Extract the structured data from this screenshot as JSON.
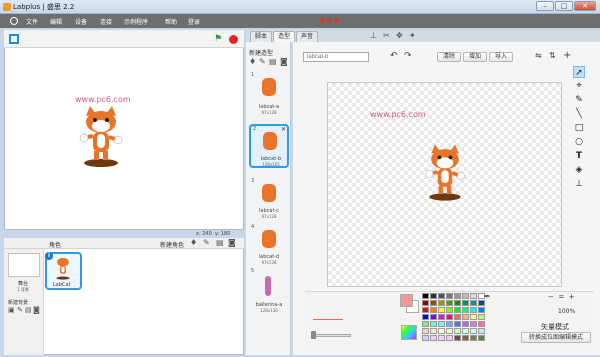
{
  "window": {
    "title": "Labplus | 盛思 2.2",
    "minimize": "–",
    "maximize": "□",
    "close": "✕"
  },
  "menu": [
    "文件",
    "编辑",
    "设备",
    "连接",
    "示例程序",
    "帮助",
    "登录"
  ],
  "stage": {
    "x_label": "x:",
    "x_value": "240",
    "y_label": "y:",
    "y_value": "180",
    "watermark": "www.pc6.com"
  },
  "sprite_pane": {
    "title": "角色",
    "new_sprite_label": "新建角色",
    "stage_label": "舞台",
    "stage_sub": "1 背景",
    "new_backdrop_label": "新建背景",
    "sprite_name": "LabCat",
    "info_glyph": "i"
  },
  "tabs": [
    "脚本",
    "造型",
    "声音"
  ],
  "costume_panel": {
    "title": "新建造型",
    "costumes": [
      {
        "num": "1",
        "name": "labcat-a",
        "size": "97x128"
      },
      {
        "num": "2",
        "name": "labcat-b",
        "size": "128x165"
      },
      {
        "num": "3",
        "name": "labcat-c",
        "size": "97x128"
      },
      {
        "num": "4",
        "name": "labcat-d",
        "size": "97x128"
      },
      {
        "num": "5",
        "name": "ballerina-a",
        "size": "128x130"
      }
    ]
  },
  "editor": {
    "name_value": "labcat-b",
    "clear": "清除",
    "add": "增加",
    "import": "导入",
    "watermark": "www.pc6.com",
    "zoom_pct": "100%",
    "zoom_minus": "−",
    "zoom_equal": "=",
    "zoom_plus": "+",
    "mode_label": "矢量模式",
    "convert_button": "转换成位图编辑模式",
    "undo": "↶",
    "redo": "↷"
  },
  "palette_colors": [
    "#000000",
    "#333333",
    "#555555",
    "#777777",
    "#999999",
    "#bbbbbb",
    "#dddddd",
    "#ffffff",
    "#990000",
    "#994c00",
    "#999900",
    "#4c9900",
    "#009900",
    "#00994c",
    "#009999",
    "#004c99",
    "#ff0000",
    "#ff8000",
    "#ffff00",
    "#80ff00",
    "#00ff00",
    "#00ff80",
    "#00ffff",
    "#0080ff",
    "#0000ff",
    "#8000ff",
    "#ff00ff",
    "#ff0080",
    "#ff6666",
    "#ffb366",
    "#ffff66",
    "#b3ff66",
    "#66ff66",
    "#66ffb3",
    "#66ffff",
    "#66b3ff",
    "#6666ff",
    "#b366ff",
    "#ff66ff",
    "#ff66b3",
    "#ffcccc",
    "#ffe6cc",
    "#ffffcc",
    "#e6ffcc",
    "#ccffcc",
    "#ccffe6",
    "#ccffff",
    "#cce6ff",
    "#ccccff",
    "#e6ccff",
    "#ffccff",
    "#ffcce6",
    "#804040",
    "#806040",
    "#808040",
    "#608040"
  ],
  "fg_color": "#f39b9b",
  "bg_color": "#ffffff"
}
